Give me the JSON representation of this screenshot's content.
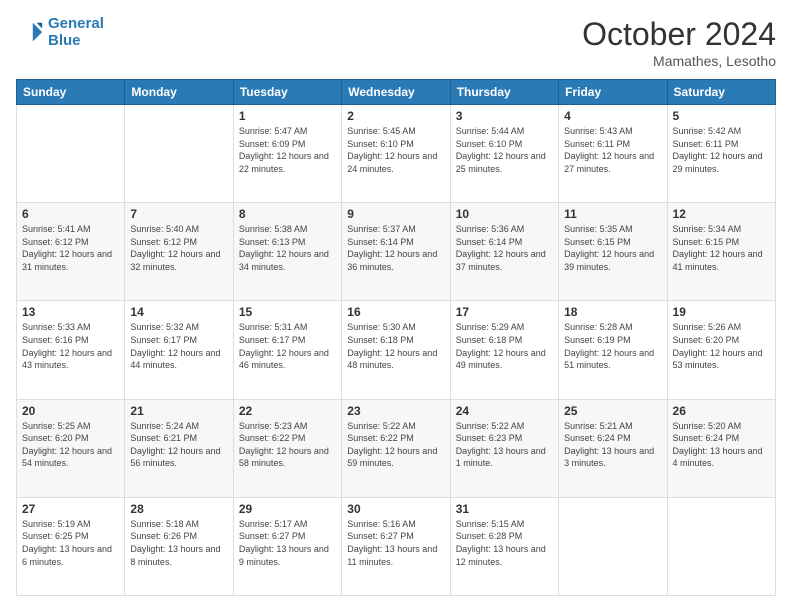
{
  "header": {
    "logo_line1": "General",
    "logo_line2": "Blue",
    "month_title": "October 2024",
    "location": "Mamathes, Lesotho"
  },
  "days_of_week": [
    "Sunday",
    "Monday",
    "Tuesday",
    "Wednesday",
    "Thursday",
    "Friday",
    "Saturday"
  ],
  "weeks": [
    [
      {
        "day": "",
        "info": ""
      },
      {
        "day": "",
        "info": ""
      },
      {
        "day": "1",
        "info": "Sunrise: 5:47 AM\nSunset: 6:09 PM\nDaylight: 12 hours\nand 22 minutes."
      },
      {
        "day": "2",
        "info": "Sunrise: 5:45 AM\nSunset: 6:10 PM\nDaylight: 12 hours\nand 24 minutes."
      },
      {
        "day": "3",
        "info": "Sunrise: 5:44 AM\nSunset: 6:10 PM\nDaylight: 12 hours\nand 25 minutes."
      },
      {
        "day": "4",
        "info": "Sunrise: 5:43 AM\nSunset: 6:11 PM\nDaylight: 12 hours\nand 27 minutes."
      },
      {
        "day": "5",
        "info": "Sunrise: 5:42 AM\nSunset: 6:11 PM\nDaylight: 12 hours\nand 29 minutes."
      }
    ],
    [
      {
        "day": "6",
        "info": "Sunrise: 5:41 AM\nSunset: 6:12 PM\nDaylight: 12 hours\nand 31 minutes."
      },
      {
        "day": "7",
        "info": "Sunrise: 5:40 AM\nSunset: 6:12 PM\nDaylight: 12 hours\nand 32 minutes."
      },
      {
        "day": "8",
        "info": "Sunrise: 5:38 AM\nSunset: 6:13 PM\nDaylight: 12 hours\nand 34 minutes."
      },
      {
        "day": "9",
        "info": "Sunrise: 5:37 AM\nSunset: 6:14 PM\nDaylight: 12 hours\nand 36 minutes."
      },
      {
        "day": "10",
        "info": "Sunrise: 5:36 AM\nSunset: 6:14 PM\nDaylight: 12 hours\nand 37 minutes."
      },
      {
        "day": "11",
        "info": "Sunrise: 5:35 AM\nSunset: 6:15 PM\nDaylight: 12 hours\nand 39 minutes."
      },
      {
        "day": "12",
        "info": "Sunrise: 5:34 AM\nSunset: 6:15 PM\nDaylight: 12 hours\nand 41 minutes."
      }
    ],
    [
      {
        "day": "13",
        "info": "Sunrise: 5:33 AM\nSunset: 6:16 PM\nDaylight: 12 hours\nand 43 minutes."
      },
      {
        "day": "14",
        "info": "Sunrise: 5:32 AM\nSunset: 6:17 PM\nDaylight: 12 hours\nand 44 minutes."
      },
      {
        "day": "15",
        "info": "Sunrise: 5:31 AM\nSunset: 6:17 PM\nDaylight: 12 hours\nand 46 minutes."
      },
      {
        "day": "16",
        "info": "Sunrise: 5:30 AM\nSunset: 6:18 PM\nDaylight: 12 hours\nand 48 minutes."
      },
      {
        "day": "17",
        "info": "Sunrise: 5:29 AM\nSunset: 6:18 PM\nDaylight: 12 hours\nand 49 minutes."
      },
      {
        "day": "18",
        "info": "Sunrise: 5:28 AM\nSunset: 6:19 PM\nDaylight: 12 hours\nand 51 minutes."
      },
      {
        "day": "19",
        "info": "Sunrise: 5:26 AM\nSunset: 6:20 PM\nDaylight: 12 hours\nand 53 minutes."
      }
    ],
    [
      {
        "day": "20",
        "info": "Sunrise: 5:25 AM\nSunset: 6:20 PM\nDaylight: 12 hours\nand 54 minutes."
      },
      {
        "day": "21",
        "info": "Sunrise: 5:24 AM\nSunset: 6:21 PM\nDaylight: 12 hours\nand 56 minutes."
      },
      {
        "day": "22",
        "info": "Sunrise: 5:23 AM\nSunset: 6:22 PM\nDaylight: 12 hours\nand 58 minutes."
      },
      {
        "day": "23",
        "info": "Sunrise: 5:22 AM\nSunset: 6:22 PM\nDaylight: 12 hours\nand 59 minutes."
      },
      {
        "day": "24",
        "info": "Sunrise: 5:22 AM\nSunset: 6:23 PM\nDaylight: 13 hours\nand 1 minute."
      },
      {
        "day": "25",
        "info": "Sunrise: 5:21 AM\nSunset: 6:24 PM\nDaylight: 13 hours\nand 3 minutes."
      },
      {
        "day": "26",
        "info": "Sunrise: 5:20 AM\nSunset: 6:24 PM\nDaylight: 13 hours\nand 4 minutes."
      }
    ],
    [
      {
        "day": "27",
        "info": "Sunrise: 5:19 AM\nSunset: 6:25 PM\nDaylight: 13 hours\nand 6 minutes."
      },
      {
        "day": "28",
        "info": "Sunrise: 5:18 AM\nSunset: 6:26 PM\nDaylight: 13 hours\nand 8 minutes."
      },
      {
        "day": "29",
        "info": "Sunrise: 5:17 AM\nSunset: 6:27 PM\nDaylight: 13 hours\nand 9 minutes."
      },
      {
        "day": "30",
        "info": "Sunrise: 5:16 AM\nSunset: 6:27 PM\nDaylight: 13 hours\nand 11 minutes."
      },
      {
        "day": "31",
        "info": "Sunrise: 5:15 AM\nSunset: 6:28 PM\nDaylight: 13 hours\nand 12 minutes."
      },
      {
        "day": "",
        "info": ""
      },
      {
        "day": "",
        "info": ""
      }
    ]
  ]
}
